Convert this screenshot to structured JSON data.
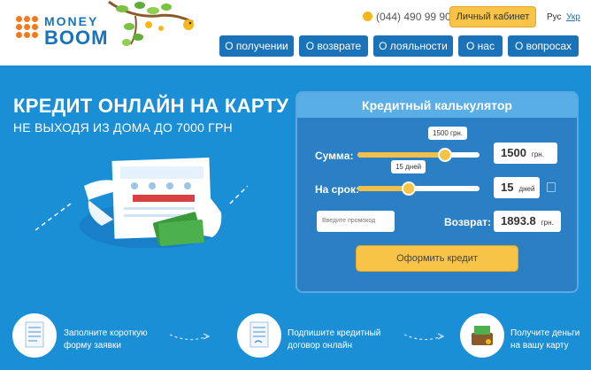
{
  "header": {
    "logo_line1": "MONEY",
    "logo_line2": "BOOM",
    "phone": "(044) 490 99 90",
    "cabinet": "Личный кабинет",
    "lang_ru": "Рус",
    "lang_ua": "Укр",
    "nav": [
      "О получении",
      "О возврате",
      "О лояльности",
      "О нас",
      "О вопросах"
    ]
  },
  "hero": {
    "title": "КРЕДИТ ОНЛАЙН НА КАРТУ",
    "subtitle": "НЕ ВЫХОДЯ ИЗ ДОМА ДО 7000 ГРН"
  },
  "calculator": {
    "title": "Кредитный калькулятор",
    "amount_label": "Сумма:",
    "amount_tooltip": "1500 грн.",
    "amount_value": "1500",
    "amount_unit": "грн.",
    "amount_fraction": 0.72,
    "term_label": "На срок:",
    "term_tooltip": "15 дней",
    "term_value": "15",
    "term_unit": "дней",
    "term_fraction": 0.42,
    "promo_placeholder": "Введите промокод",
    "return_label": "Возврат:",
    "return_value": "1893.8",
    "return_unit": "грн.",
    "submit": "Оформить кредит"
  },
  "steps": [
    {
      "line1": "Заполните короткую",
      "line2": "форму заявки"
    },
    {
      "line1": "Подпишите кредитный",
      "line2": "договор онлайн"
    },
    {
      "line1": "Получите деньги",
      "line2": "на вашу карту"
    }
  ],
  "colors": {
    "brand_blue": "#1a73b8",
    "accent": "#f7c447",
    "bg": "#1a8fd6"
  }
}
